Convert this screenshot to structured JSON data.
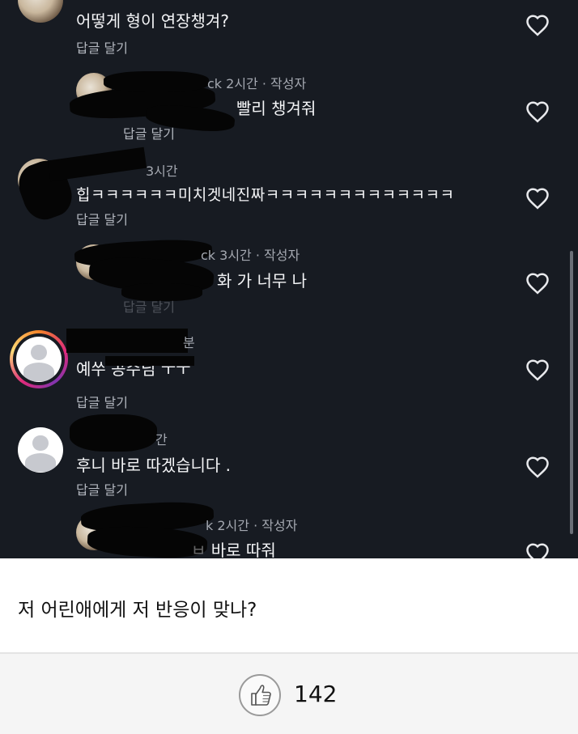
{
  "comments": [
    {
      "text": "어떻게 형이 연장챙겨?",
      "reply": "답글 달기"
    },
    {
      "meta": "2시간 · 작성자",
      "meta_prefix": "ck",
      "text": "빨리 챙겨줘",
      "reply": "답글 달기"
    },
    {
      "meta": "3시간",
      "text_prefix": "힙",
      "text": "ㅋㅋㅋㅋㅋㅋ미치겟네진짜ㅋㅋㅋㅋㅋㅋㅋㅋㅋㅋㅋㅋㅋ",
      "reply": "답글 달기"
    },
    {
      "meta": "3시간 · 작성자",
      "meta_prefix": "ck",
      "text": "화 가 너무 나",
      "reply": "답글 달기"
    },
    {
      "meta": "분",
      "text": "예쑤 공수님 ㅜㅜ",
      "reply": "답글 달기"
    },
    {
      "meta": "간",
      "text": "후니 바로 따겠습니다 .",
      "reply": "답글 달기"
    },
    {
      "meta": "2시간 · 작성자",
      "meta_prefix": "k",
      "text": "바로 따줘",
      "text_prefix": "ㅂ"
    }
  ],
  "post": {
    "text": "저 어린애에게 저 반응이 맞나?",
    "like_count": "142"
  },
  "icons": {
    "heart": "heart-outline-icon",
    "like": "thumbs-up-icon",
    "avatar": "default-avatar-icon"
  },
  "colors": {
    "dark_bg": "#171b22",
    "story_ring": "#dd2a7b"
  }
}
